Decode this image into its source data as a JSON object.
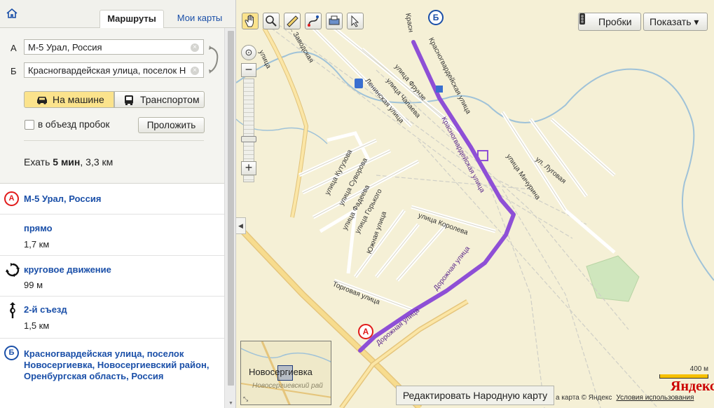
{
  "topbar": {
    "home_icon": "home-icon",
    "tab_routes": "Маршруты",
    "tab_mymaps": "Мои карты"
  },
  "form": {
    "point_a_letter": "А",
    "point_b_letter": "Б",
    "point_a_value": "М-5 Урал, Россия",
    "point_b_value": "Красногвардейская улица, поселок Н",
    "mode_car": "На машине",
    "mode_transit": "Транспортом",
    "avoid_traffic": "в объезд пробок",
    "build_button": "Проложить",
    "summary_prefix": "Ехать ",
    "summary_time": "5 мин",
    "summary_suffix": ", 3,3 км"
  },
  "steps": [
    {
      "title": "М-5 Урал, Россия",
      "badge": "А"
    },
    {
      "title": "прямо",
      "distance": "1,7 км"
    },
    {
      "title": "круговое движение",
      "distance": "99 м"
    },
    {
      "title": "2-й съезд",
      "distance": "1,5 км"
    },
    {
      "title": "Красногвардейская улица, поселок Новосергиевка, Новосергиевский район, Оренбургская область, Россия",
      "badge": "Б"
    }
  ],
  "map": {
    "traffic_button": "Пробки",
    "show_button": "Показать ▾",
    "scale_label": "400 м",
    "edit_button": "Редактировать Народную карту",
    "copyright": "а карта © Яндекс",
    "terms_link": "Условия использования",
    "logo": "Яндекс",
    "minimap_label": "Новосергиевка",
    "minimap_sublabel": "Новосергиевский рай",
    "pin_a": "А",
    "pin_b": "Б",
    "route_color": "#8e4fd6",
    "streets": [
      "ул. Заводская",
      "улица",
      "Красногвардейская улица",
      "Ленинская улица",
      "улица Фрунзе",
      "улица Чапаева",
      "Красногвардейская улица",
      "улица Кутузова",
      "улица Суворова",
      "улица Фадеева",
      "улица Горького",
      "Южная улица",
      "улица Королева",
      "улица Мичурина",
      "ул. Луговая",
      "Дорожная улица",
      "Торговая улица",
      "Дорожная улица",
      "Красн"
    ]
  }
}
